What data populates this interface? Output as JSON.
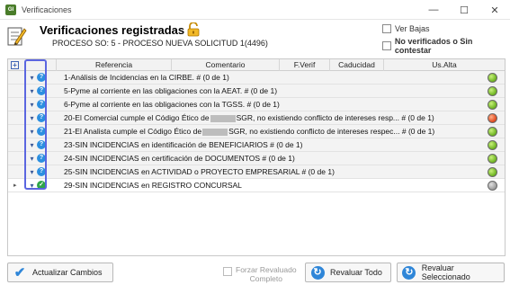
{
  "window": {
    "title": "Verificaciones",
    "app_icon_text": "GI",
    "controls": {
      "minimize": "—",
      "maximize": "☐",
      "close": "✕"
    }
  },
  "header": {
    "title": "Verificaciones registradas",
    "subtitle": "PROCESO SO: 5 - PROCESO NUEVA SOLICITUD 1(4496)",
    "ver_bajas_label": "Ver Bajas",
    "no_verificados_label": "No verificados o Sin contestar"
  },
  "grid": {
    "columns": {
      "referencia": "Referencia",
      "comentario": "Comentario",
      "fverif": "F.Verif",
      "caducidad": "Caducidad",
      "usalta": "Us.Alta"
    },
    "rows": [
      {
        "text": "1-Análisis de Incidencias en la CIRBE. # (0 de 1)",
        "status_icon": "question-icon",
        "status_color": "green"
      },
      {
        "text": "5-Pyme al corriente en las obligaciones con la AEAT. # (0 de 1)",
        "status_icon": "question-icon",
        "status_color": "green"
      },
      {
        "text": "6-Pyme al corriente en las obligaciones con la TGSS. # (0 de 1)",
        "status_icon": "question-icon",
        "status_color": "green"
      },
      {
        "text_a": "20-El Comercial cumple el Código Ético de",
        "text_b": "SGR, no existiendo conflicto de intereses resp... # (0 de 1)",
        "status_icon": "question-icon",
        "status_color": "red"
      },
      {
        "text_a": "21-El Analista cumple el Código Ético de",
        "text_b": "SGR, no existiendo conflicto de intereses respec... # (0 de 1)",
        "status_icon": "question-icon",
        "status_color": "green"
      },
      {
        "text": "23-SIN INCIDENCIAS en identificación de BENEFICIARIOS # (0 de 1)",
        "status_icon": "question-icon",
        "status_color": "green"
      },
      {
        "text": "24-SIN INCIDENCIAS en certificación de DOCUMENTOS # (0 de 1)",
        "status_icon": "question-icon",
        "status_color": "green"
      },
      {
        "text": "25-SIN INCIDENCIAS en ACTIVIDAD o PROYECTO EMPRESARIAL # (0 de 1)",
        "status_icon": "question-icon",
        "status_color": "green"
      },
      {
        "text": "29-SIN INCIDENCIAS en REGISTRO CONCURSAL",
        "status_icon": "check-icon",
        "status_color": "grey"
      }
    ]
  },
  "footer": {
    "actualizar_label": "Actualizar Cambios",
    "forzar_line1": "Forzar Revaluado",
    "forzar_line2": "Completo",
    "revaluar_todo_label": "Revaluar Todo",
    "revaluar_sel_label": "Revaluar Seleccionado"
  },
  "colors": {
    "question": "#2b8fe0",
    "ok": "#2fa64a",
    "highlight": "#5b66e0"
  }
}
